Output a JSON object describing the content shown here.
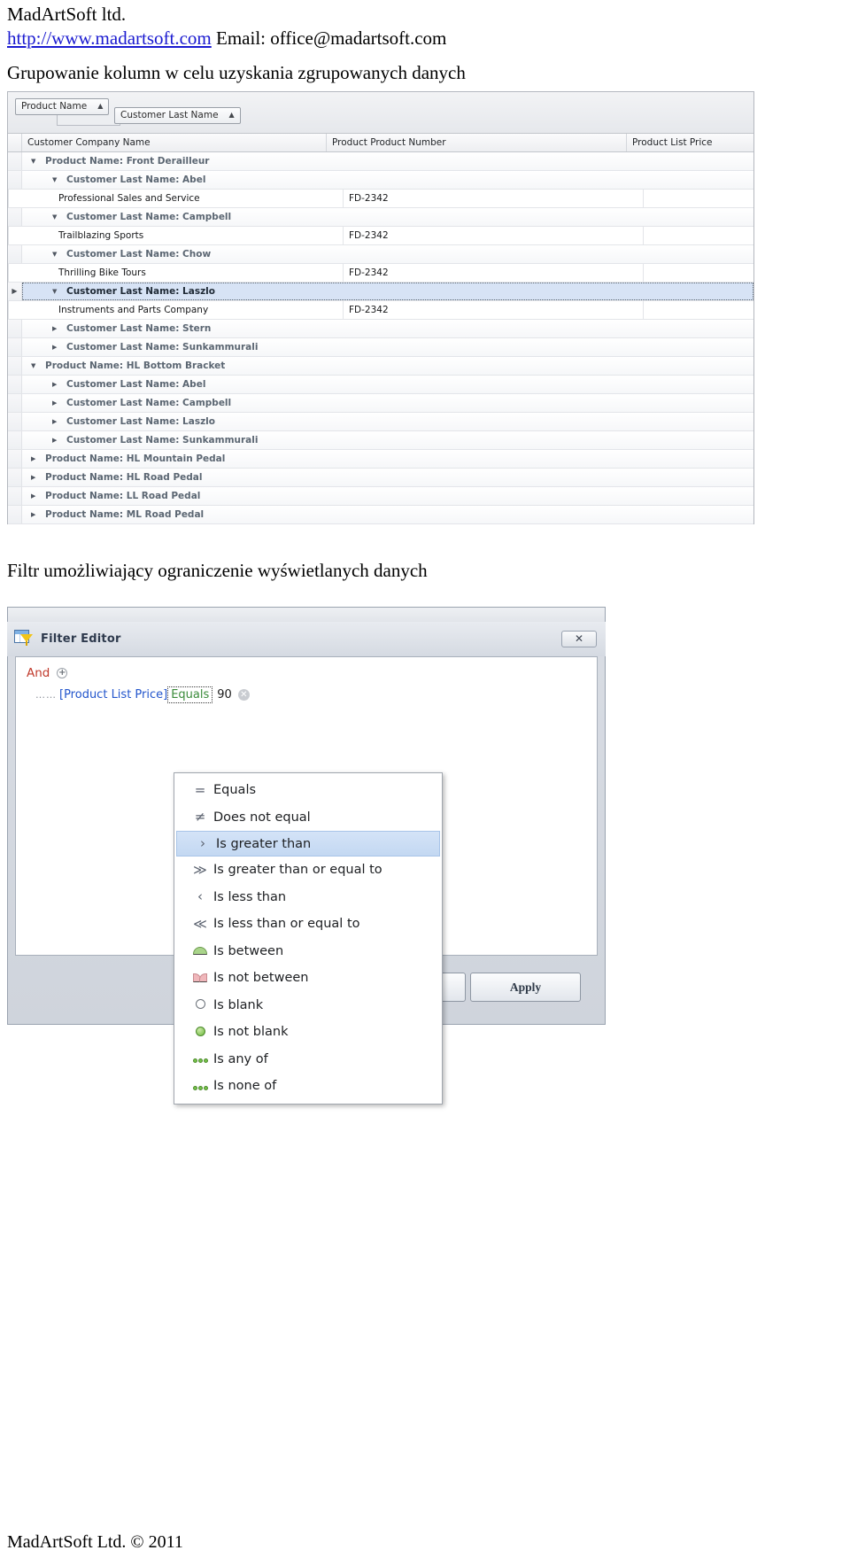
{
  "document": {
    "company": "MadArtSoft ltd.",
    "website": "http://www.madartsoft.com",
    "email_label": "Email: office@madartsoft.com",
    "section1_title": "Grupowanie kolumn w celu uzyskania zgrupowanych danych",
    "section2_title": "Filtr umożliwiający ograniczenie wyświetlanych danych",
    "footer": "MadArtSoft Ltd. © 2011"
  },
  "grid": {
    "group_panel": {
      "chips": [
        {
          "label": "Product Name",
          "sort": "▲"
        },
        {
          "label": "Customer Last Name",
          "sort": "▲"
        }
      ]
    },
    "columns": [
      {
        "label": "Customer Company Name"
      },
      {
        "label": "Product Product Number"
      },
      {
        "label": "Product List Price"
      }
    ],
    "rows": [
      {
        "type": "group",
        "level": 1,
        "expanded": true,
        "label": "Product Name: Front Derailleur"
      },
      {
        "type": "group",
        "level": 2,
        "expanded": true,
        "label": "Customer Last Name: Abel"
      },
      {
        "type": "data",
        "company": "Professional Sales and Service",
        "number": "FD-2342",
        "price": ""
      },
      {
        "type": "group",
        "level": 2,
        "expanded": true,
        "label": "Customer Last Name: Campbell"
      },
      {
        "type": "data",
        "company": "Trailblazing Sports",
        "number": "FD-2342",
        "price": ""
      },
      {
        "type": "group",
        "level": 2,
        "expanded": true,
        "label": "Customer Last Name: Chow"
      },
      {
        "type": "data",
        "company": "Thrilling Bike Tours",
        "number": "FD-2342",
        "price": ""
      },
      {
        "type": "group",
        "level": 2,
        "expanded": true,
        "label": "Customer Last Name: Laszlo",
        "selected": true
      },
      {
        "type": "data",
        "company": "Instruments and Parts Company",
        "number": "FD-2342",
        "price": ""
      },
      {
        "type": "group",
        "level": 2,
        "expanded": false,
        "label": "Customer Last Name: Stern"
      },
      {
        "type": "group",
        "level": 2,
        "expanded": false,
        "label": "Customer Last Name: Sunkammurali"
      },
      {
        "type": "group",
        "level": 1,
        "expanded": true,
        "label": "Product Name: HL Bottom Bracket"
      },
      {
        "type": "group",
        "level": 2,
        "expanded": false,
        "label": "Customer Last Name: Abel"
      },
      {
        "type": "group",
        "level": 2,
        "expanded": false,
        "label": "Customer Last Name: Campbell"
      },
      {
        "type": "group",
        "level": 2,
        "expanded": false,
        "label": "Customer Last Name: Laszlo"
      },
      {
        "type": "group",
        "level": 2,
        "expanded": false,
        "label": "Customer Last Name: Sunkammurali"
      },
      {
        "type": "group",
        "level": 1,
        "expanded": false,
        "label": "Product Name: HL Mountain Pedal"
      },
      {
        "type": "group",
        "level": 1,
        "expanded": false,
        "label": "Product Name: HL Road Pedal"
      },
      {
        "type": "group",
        "level": 1,
        "expanded": false,
        "label": "Product Name: LL Road Pedal"
      },
      {
        "type": "group",
        "level": 1,
        "expanded": false,
        "label": "Product Name: ML Road Pedal"
      }
    ]
  },
  "filter_editor": {
    "title": "Filter Editor",
    "close_label": "✕",
    "and_label": "And",
    "add_label": "+",
    "condition": {
      "field": "[Product List Price]",
      "operator": "Equals",
      "value": "90",
      "delete_label": "✕"
    },
    "apply_label": "Apply",
    "operator_menu": [
      {
        "label": "Equals",
        "icon": "equals-icon",
        "glyph": "="
      },
      {
        "label": "Does not equal",
        "icon": "not-equals-icon",
        "glyph": "≠"
      },
      {
        "label": "Is greater than",
        "icon": "greater-than-icon",
        "glyph": "›",
        "selected": true
      },
      {
        "label": "Is greater than or equal to",
        "icon": "greater-than-or-equal-icon",
        "glyph": "≫"
      },
      {
        "label": "Is less than",
        "icon": "less-than-icon",
        "glyph": "‹"
      },
      {
        "label": "Is less than or equal to",
        "icon": "less-than-or-equal-icon",
        "glyph": "≪"
      },
      {
        "label": "Is between",
        "icon": "between-icon",
        "glyph": "dome"
      },
      {
        "label": "Is not between",
        "icon": "not-between-icon",
        "glyph": "dome-inv"
      },
      {
        "label": "Is blank",
        "icon": "blank-circle-icon",
        "glyph": "circ-open"
      },
      {
        "label": "Is not blank",
        "icon": "filled-circle-icon",
        "glyph": "circ-green"
      },
      {
        "label": "Is any of",
        "icon": "any-of-icon",
        "glyph": "dots"
      },
      {
        "label": "Is none of",
        "icon": "none-of-icon",
        "glyph": "dots"
      }
    ]
  },
  "colors": {
    "link": "#1a1ad0",
    "group_text": "#5b6672",
    "selection": "#d7e3f5",
    "field": "#2255cc",
    "operator": "#3a8b3a",
    "and": "#c0392b"
  }
}
